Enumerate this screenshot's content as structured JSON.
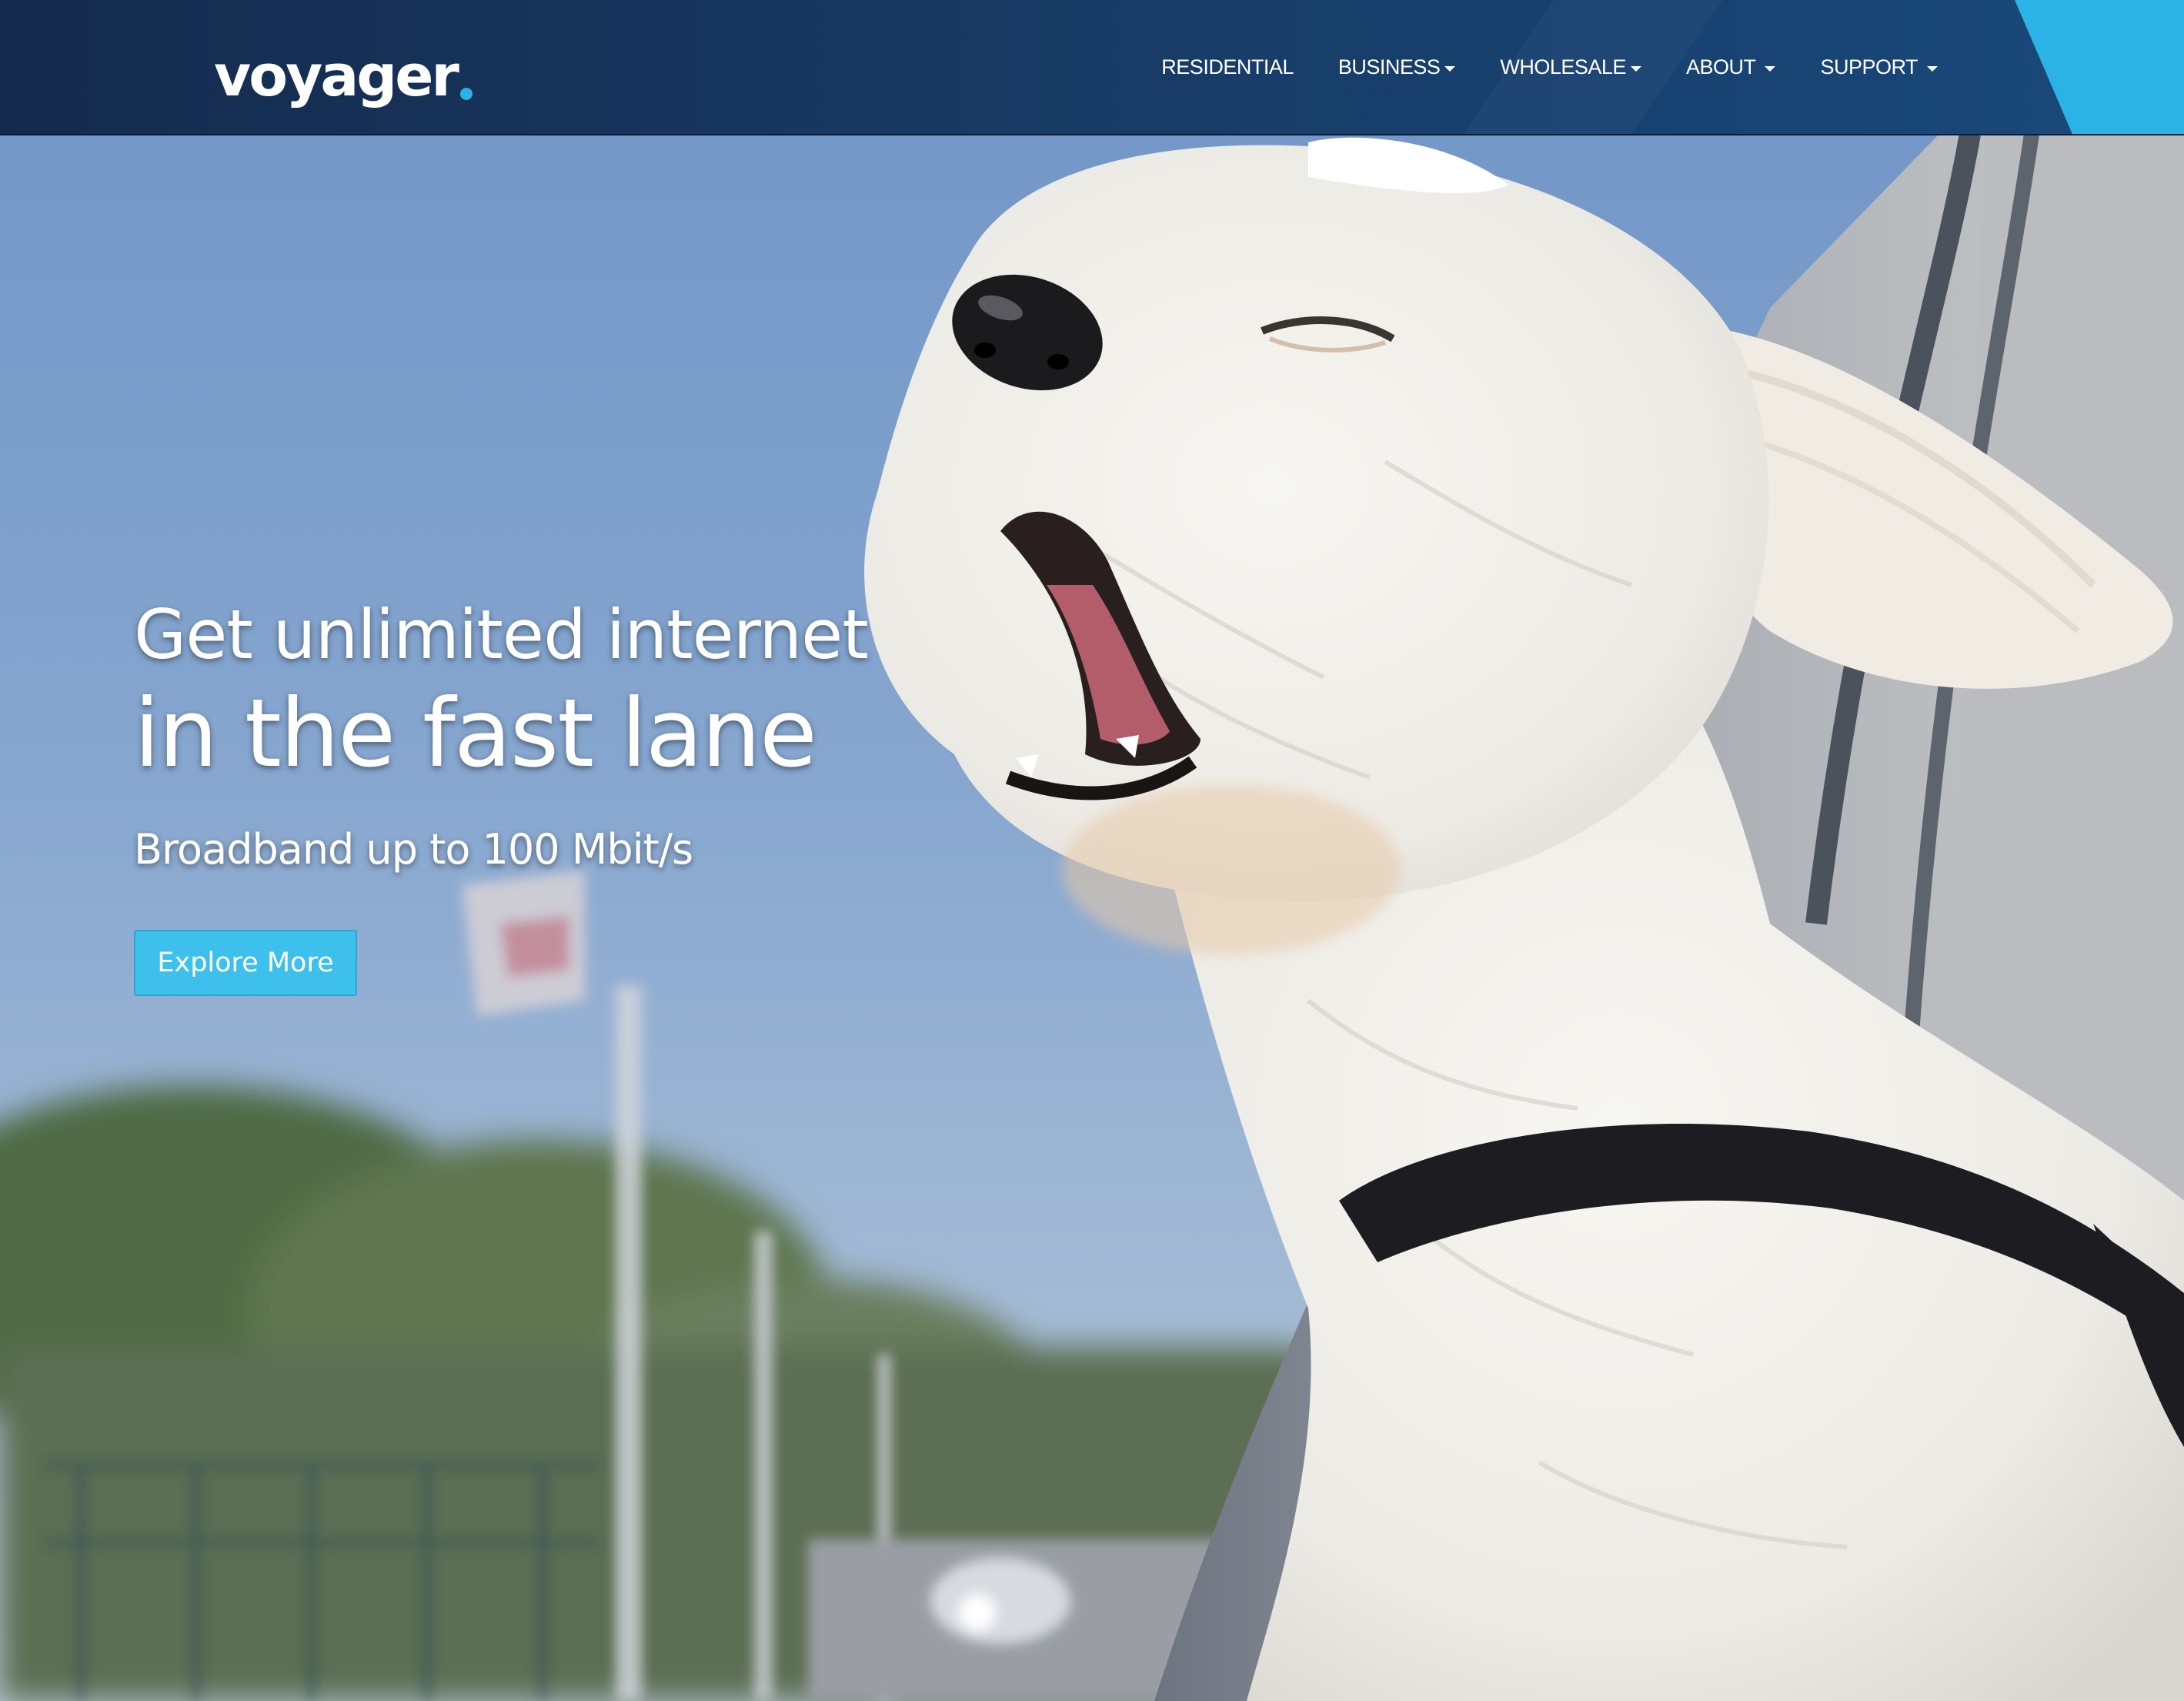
{
  "brand": {
    "logo_text": "voyager",
    "primary_color": "#183a63",
    "accent_color": "#2ab3e4"
  },
  "nav": {
    "items": [
      {
        "label": "RESIDENTIAL",
        "has_dropdown": false
      },
      {
        "label": "BUSINESS",
        "has_dropdown": true
      },
      {
        "label": "WHOLESALE",
        "has_dropdown": true
      },
      {
        "label": "ABOUT",
        "has_dropdown": true
      },
      {
        "label": "SUPPORT",
        "has_dropdown": true
      }
    ]
  },
  "hero": {
    "headline_line1": "Get unlimited internet",
    "headline_line2": "in the fast lane",
    "subheadline": "Broadband up to 100 Mbit/s",
    "cta_label": "Explore More",
    "cta_color": "#3dc0ec",
    "image_subject": "white dog with head out of car window"
  }
}
